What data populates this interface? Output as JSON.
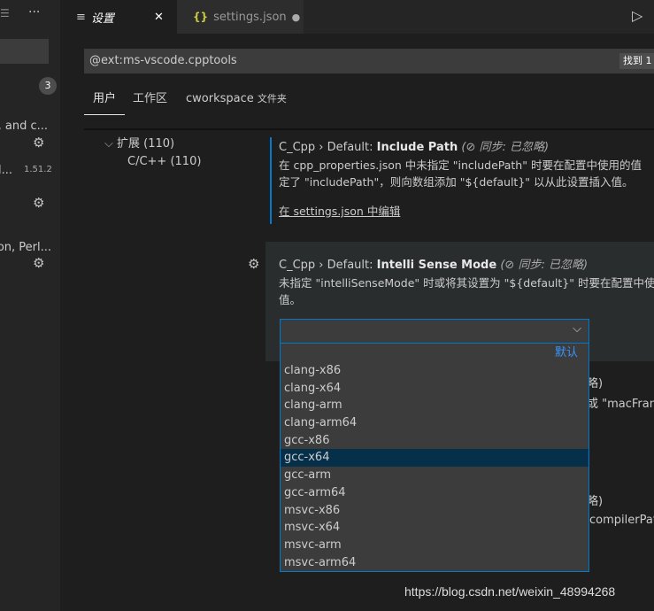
{
  "sidebar": {
    "badge": "3",
    "items": [
      {
        "text": ", and c..."
      },
      {
        "text": "l...",
        "version": "1.51.2"
      },
      {
        "text": "on, Perl..."
      }
    ]
  },
  "tabs": [
    {
      "label": "设置",
      "icon": "settings-list-icon",
      "close": "✕"
    },
    {
      "label": "settings.json",
      "icon": "json-braces-icon",
      "dirty": "●"
    }
  ],
  "search": {
    "value": "@ext:ms-vscode.cpptools",
    "results": "找到 1"
  },
  "scope_tabs": [
    {
      "label": "用户",
      "active": true
    },
    {
      "label": "工作区"
    },
    {
      "label": "cworkspace",
      "suffix": "文件夹"
    }
  ],
  "toc": {
    "group": "扩展 (110)",
    "item": "C/C++ (110)"
  },
  "settings": [
    {
      "prefix": "C_Cpp › Default: ",
      "name": "Include Path",
      "sync": "同步: 已忽略",
      "desc1": "在 cpp_properties.json 中未指定 \"includePath\" 时要在配置中使用的值",
      "desc2": "定了 \"includePath\"，则向数组添加 \"${default}\" 以从此设置插入值。",
      "link": "在 settings.json 中编辑"
    },
    {
      "prefix": "C_Cpp › Default: ",
      "name": "Intelli Sense Mode",
      "sync": "同步: 已忽略",
      "desc1": "未指定 \"intelliSenseMode\" 时或将其设置为 \"${default}\" 时要在配置中使用的",
      "desc2": "值。",
      "select_value": "",
      "default_label": "默认"
    }
  ],
  "dropdown": {
    "options": [
      "clang-x86",
      "clang-x64",
      "clang-arm",
      "clang-arm64",
      "gcc-x86",
      "gcc-x64",
      "gcc-arm",
      "gcc-arm64",
      "msvc-x86",
      "msvc-x64",
      "msvc-arm",
      "msvc-arm64"
    ],
    "selected": "gcc-x64"
  },
  "behind": {
    "t1": "略)",
    "t2": "或 \"macFram",
    "t3": "略)",
    "t4": "compilerPat"
  },
  "watermark": "https://blog.csdn.net/weixin_48994268",
  "colors": {
    "accent": "#007acc",
    "selected": "#062f4a",
    "link": "#3794ff"
  }
}
